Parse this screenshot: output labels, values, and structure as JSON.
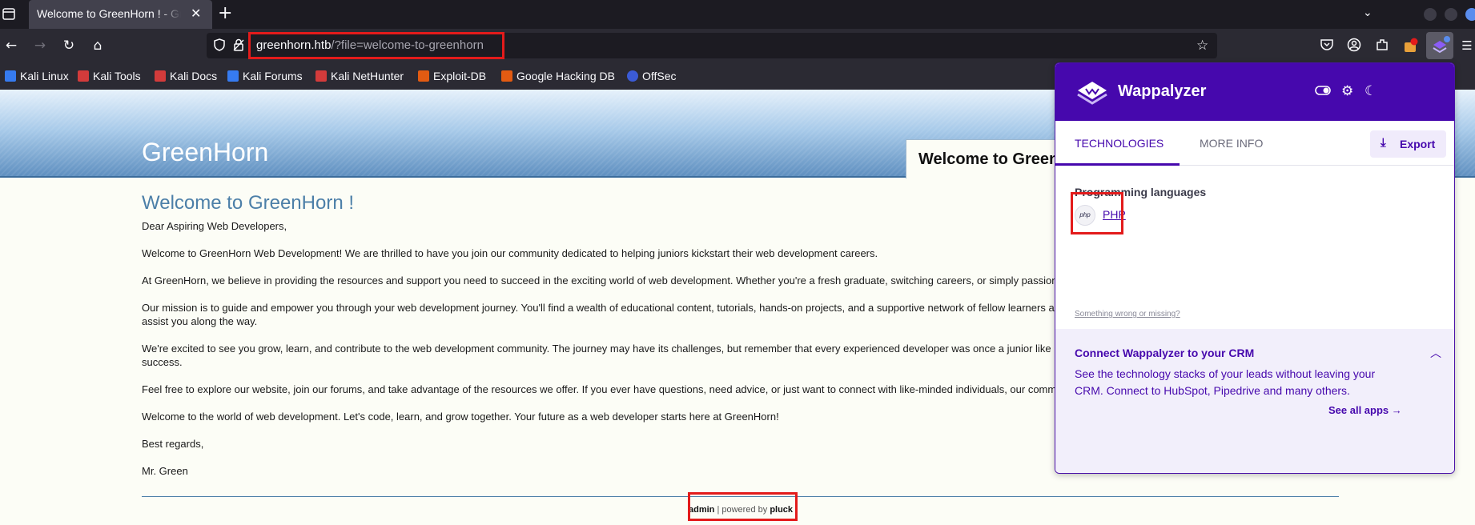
{
  "browser": {
    "tab_title": "Welcome to GreenHorn ! - GreenHorn",
    "url_host": "greenhorn.htb",
    "url_path": "/?file=welcome-to-greenhorn",
    "icons": [
      "tab-list-icon",
      "close-icon",
      "new-tab-icon",
      "chevron-down-icon",
      "back-icon",
      "forward-icon",
      "reload-icon",
      "home-icon",
      "shield-icon",
      "lock-icon",
      "star-icon",
      "pocket-icon",
      "account-icon",
      "extensions-icon",
      "menu-icon"
    ]
  },
  "bookmarks": [
    {
      "label": "Kali Linux",
      "color": "#367bf0"
    },
    {
      "label": "Kali Tools",
      "color": "#d33b3b"
    },
    {
      "label": "Kali Docs",
      "color": "#d33b3b"
    },
    {
      "label": "Kali Forums",
      "color": "#367bf0"
    },
    {
      "label": "Kali NetHunter",
      "color": "#d33b3b"
    },
    {
      "label": "Exploit-DB",
      "color": "#e25b12"
    },
    {
      "label": "Google Hacking DB",
      "color": "#e25b12"
    },
    {
      "label": "OffSec",
      "color": "#3b5bd6"
    }
  ],
  "page": {
    "site_title": "GreenHorn",
    "nav_tab": "Welcome to GreenHorn !",
    "heading": "Welcome to GreenHorn !",
    "paragraphs": [
      "Dear Aspiring Web Developers,",
      "Welcome to GreenHorn Web Development! We are thrilled to have you join our community dedicated to helping juniors kickstart their web development careers.",
      "At GreenHorn, we believe in providing the resources and support you need to succeed in the exciting world of web development. Whether you're a fresh graduate, switching careers, or simply passion",
      "Our mission is to guide and empower you through your web development journey. You'll find a wealth of educational content, tutorials, hands-on projects, and a supportive network of fellow learners a",
      "assist you along the way.",
      "We're excited to see you grow, learn, and contribute to the web development community. The journey may have its challenges, but remember that every experienced developer was once a junior like",
      "success.",
      "Feel free to explore our website, join our forums, and take advantage of the resources we offer. If you ever have questions, need advice, or just want to connect with like-minded individuals, our comm",
      "Welcome to the world of web development. Let's code, learn, and grow together. Your future as a web developer starts here at GreenHorn!",
      "Best regards,",
      "Mr. Green"
    ],
    "footer_admin": "admin",
    "footer_sep": " | powered by ",
    "footer_pluck": "pluck"
  },
  "wappalyzer": {
    "title": "Wappalyzer",
    "tab_technologies": "TECHNOLOGIES",
    "tab_more_info": "MORE INFO",
    "export_label": "Export",
    "category": "Programming languages",
    "tech_name": "PHP",
    "tech_icon_text": "php",
    "wrong_link": "Something wrong or missing?",
    "crm_title": "Connect Wappalyzer to your CRM",
    "crm_text": "See the technology stacks of your leads without leaving your CRM. Connect to HubSpot, Pipedrive and many others.",
    "crm_link": "See all apps",
    "accent_color": "#4608ad"
  }
}
